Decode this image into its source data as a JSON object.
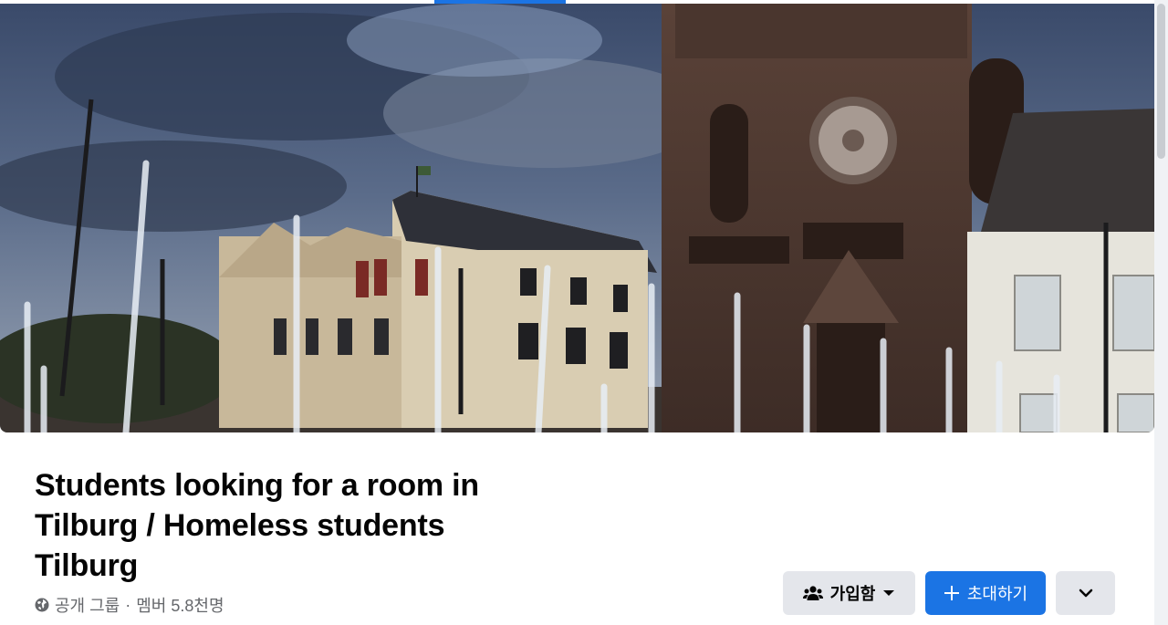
{
  "group": {
    "title": "Students looking for a room in Tilburg / Homeless students Tilburg",
    "privacy": "공개 그룹",
    "separator": "·",
    "members": "멤버 5.8천명"
  },
  "actions": {
    "joined_label": "가입함",
    "invite_label": "초대하기"
  },
  "icons": {
    "globe": "globe-icon",
    "members": "group-members-icon",
    "dropdown": "caret-down-icon",
    "invite": "plus-icon",
    "more": "chevron-down-icon"
  },
  "colors": {
    "primary": "#1b74e4",
    "secondary_button": "#e4e6eb",
    "text": "#050505",
    "muted_text": "#65676b"
  }
}
